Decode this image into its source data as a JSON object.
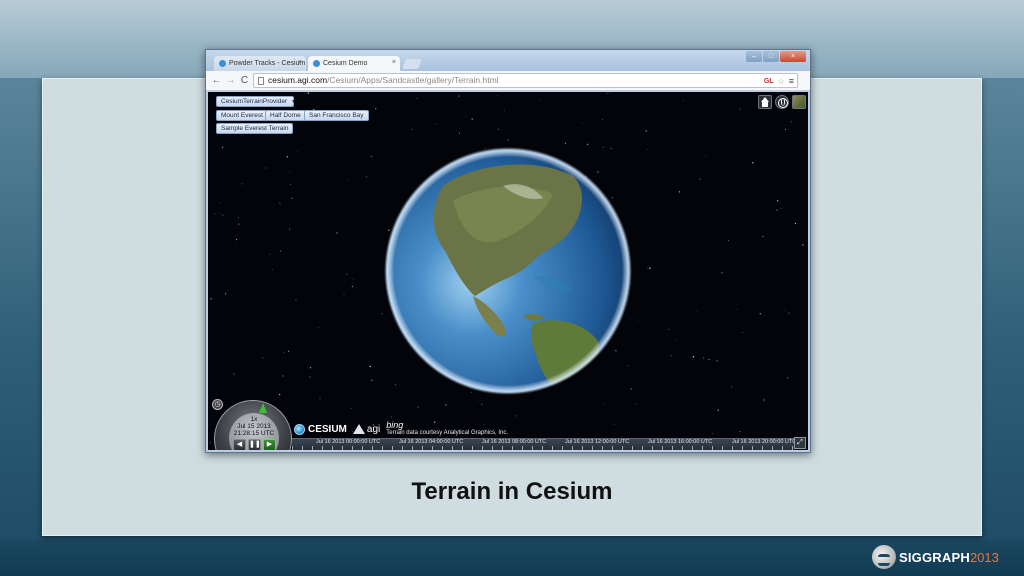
{
  "slide": {
    "caption": "Terrain in Cesium",
    "branding": {
      "text": "SIGGRAPH",
      "year": "2013",
      "accent_color": "#e8763a"
    }
  },
  "browser": {
    "tabs": [
      {
        "label": "Powder Tracks - Cesium",
        "close": "×"
      },
      {
        "label": "Cesium Demo",
        "close": "×"
      }
    ],
    "window_controls": {
      "minimize": "–",
      "maximize": "□",
      "close": "×"
    },
    "nav": {
      "back": "←",
      "forward": "→",
      "reload": "C"
    },
    "address": {
      "host": "cesium.agi.com",
      "path": "/Cesium/Apps/Sandcastle/gallery/Terrain.html"
    },
    "omnibox_icons": {
      "gl": "GL",
      "star": "☆",
      "menu": "≡"
    }
  },
  "viewer": {
    "provider_select": {
      "value": "CesiumTerrainProvider",
      "caret": "▼"
    },
    "buttons": {
      "mount_everest": "Mount Everest",
      "half_dome": "Half Dome",
      "san_francisco_bay": "San Francisco Bay",
      "sample_everest": "Sample Everest Terrain"
    },
    "animation": {
      "speed": "1x",
      "date": "Jul 15 2013",
      "time": "21:28:15 UTC",
      "reverse": "◀",
      "pause": "❚❚",
      "play": "▶"
    },
    "clock_icon": "◷",
    "credits": {
      "cesium": "CESIUM",
      "agi": "agi",
      "bing": "bing",
      "terrain": "Terrain data courtesy Analytical Graphics, Inc."
    },
    "timeline": [
      "Jul 16 2013 00:00:00 UTC",
      "Jul 16 2013 04:00:00 UTC",
      "Jul 16 2013 08:00:00 UTC",
      "Jul 16 2013 12:00:00 UTC",
      "Jul 16 2013 16:00:00 UTC",
      "Jul 16 2013 20:00:00 UTC"
    ],
    "fullscreen": "⤢"
  },
  "colors": {
    "space": "#03040a",
    "ocean": "#2f6aa8",
    "land": "#6f7a4a",
    "active_play": "#3b8f37"
  }
}
